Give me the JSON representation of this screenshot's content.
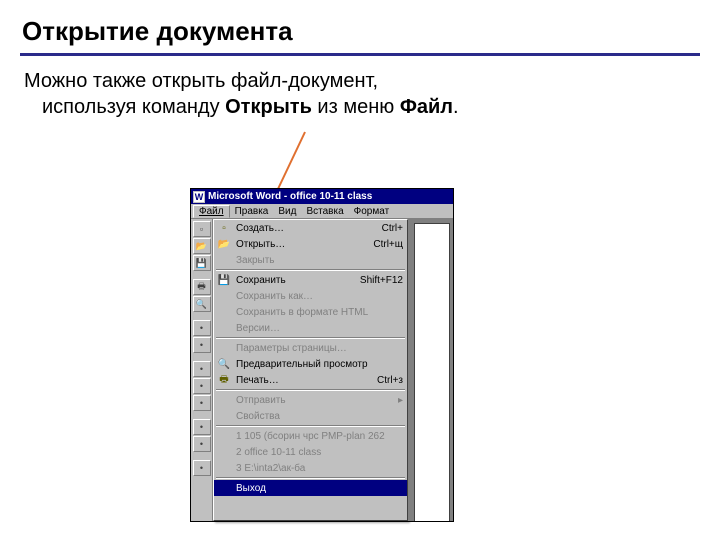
{
  "title": "Открытие документа",
  "body": {
    "line1": "Можно также открыть файл-документ,",
    "line2_a": "используя команду ",
    "line2_b": "Открыть",
    "line2_c": " из меню ",
    "line2_d": "Файл",
    "line2_e": "."
  },
  "window": {
    "app_icon": "W",
    "caption": "Microsoft Word - office 10-11 class",
    "menubar": {
      "file": "Файл",
      "edit": "Правка",
      "view": "Вид",
      "insert": "Вставка",
      "format": "Формат"
    },
    "dropdown": {
      "create": {
        "label": "Создать…",
        "shortcut": "Ctrl+"
      },
      "open": {
        "label": "Открыть…",
        "shortcut": "Ctrl+щ"
      },
      "close": {
        "label": "Закрыть"
      },
      "save": {
        "label": "Сохранить",
        "shortcut": "Shift+F12"
      },
      "saveas": {
        "label": "Сохранить как…"
      },
      "savehtml": {
        "label": "Сохранить в формате HTML"
      },
      "versions": {
        "label": "Версии…"
      },
      "pagesetup": {
        "label": "Параметры страницы…"
      },
      "preview": {
        "label": "Предварительный просмотр"
      },
      "print": {
        "label": "Печать…",
        "shortcut": "Ctrl+з"
      },
      "send": {
        "label": "Отправить"
      },
      "properties": {
        "label": "Свойства"
      },
      "recent1": "1 105 (бсорин чрс РМР-plan 262",
      "recent2": "2 office 10-11 class",
      "recent3": "3 Е:\\inta2\\ак-ба",
      "exit": "Выход"
    }
  },
  "icons": {
    "new": "▫",
    "open": "📂",
    "save": "💾",
    "print": "🖶",
    "preview": "🔍",
    "arrow": "▸"
  }
}
